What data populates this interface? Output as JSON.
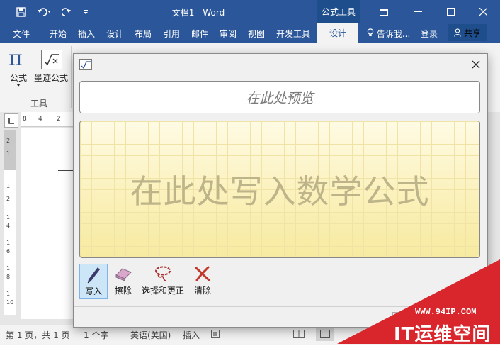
{
  "window": {
    "title": "文档1 - Word",
    "context_tab_group": "公式工具"
  },
  "ribbon_tabs": [
    "文件",
    "开始",
    "插入",
    "设计",
    "布局",
    "引用",
    "邮件",
    "审阅",
    "视图",
    "开发工具",
    "设计"
  ],
  "active_tab_index": 10,
  "tell_me": "告诉我...",
  "login": "登录",
  "share": "共享",
  "ribbon": {
    "equation_label": "公式",
    "ink_equation_label": "墨迹公式",
    "group_label": "工具",
    "pi_symbol": "π"
  },
  "ruler": {
    "horizontal_ticks": [
      "8",
      "4",
      "2"
    ],
    "vertical_ticks": [
      "2",
      "1",
      "1",
      "2",
      "1",
      "4",
      "1",
      "6",
      "1",
      "8",
      "1",
      "10"
    ]
  },
  "dialog": {
    "preview_placeholder": "在此处预览",
    "canvas_hint": "在此处写入数学公式",
    "tools": [
      {
        "label": "写入",
        "icon": "pen-icon",
        "selected": true
      },
      {
        "label": "擦除",
        "icon": "eraser-icon",
        "selected": false
      },
      {
        "label": "选择和更正",
        "icon": "lasso-icon",
        "selected": false
      },
      {
        "label": "清除",
        "icon": "clear-icon",
        "selected": false
      }
    ]
  },
  "status_bar": {
    "page": "第 1 页，共 1 页",
    "words": "1 个字",
    "language": "英语(美国)",
    "mode": "插入"
  },
  "watermark": {
    "url": "WWW.94IP.COM",
    "brand": "IT运维空间"
  },
  "colors": {
    "word_blue": "#2b579a",
    "canvas_yellow": "#fbf3c2",
    "watermark_red": "#d9262c"
  }
}
